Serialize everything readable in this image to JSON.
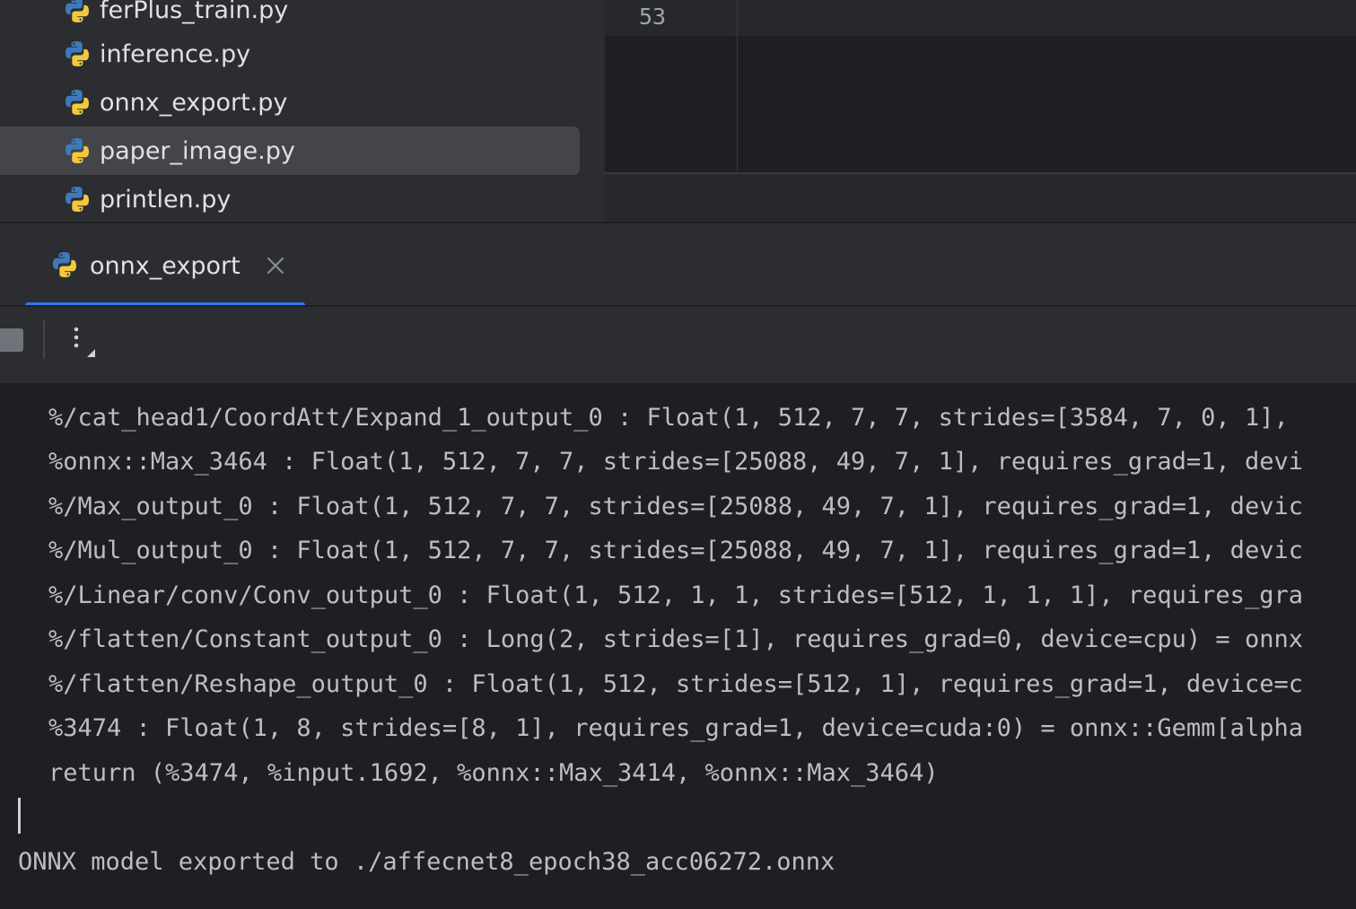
{
  "project_tree": {
    "items": [
      {
        "label": "ferPlus_train.py",
        "icon": "python-file-icon",
        "selected": false
      },
      {
        "label": "inference.py",
        "icon": "python-file-icon",
        "selected": false
      },
      {
        "label": "onnx_export.py",
        "icon": "python-file-icon",
        "selected": false
      },
      {
        "label": "paper_image.py",
        "icon": "python-file-icon",
        "selected": true
      },
      {
        "label": "printlen.py",
        "icon": "python-file-icon",
        "selected": false
      }
    ]
  },
  "editor": {
    "line_number": "53"
  },
  "run_window": {
    "tab": {
      "label": "onnx_export",
      "icon": "python-file-icon",
      "close_icon": "close-icon"
    },
    "toolbar": {
      "stop_icon": "stop-icon",
      "more_icon": "more-vertical-icon"
    }
  },
  "console": {
    "lines": [
      "%/cat_head1/CoordAtt/Expand_1_output_0 : Float(1, 512, 7, 7, strides=[3584, 7, 0, 1], ",
      "%onnx::Max_3464 : Float(1, 512, 7, 7, strides=[25088, 49, 7, 1], requires_grad=1, devi",
      "%/Max_output_0 : Float(1, 512, 7, 7, strides=[25088, 49, 7, 1], requires_grad=1, devic",
      "%/Mul_output_0 : Float(1, 512, 7, 7, strides=[25088, 49, 7, 1], requires_grad=1, devic",
      "%/Linear/conv/Conv_output_0 : Float(1, 512, 1, 1, strides=[512, 1, 1, 1], requires_gra",
      "%/flatten/Constant_output_0 : Long(2, strides=[1], requires_grad=0, device=cpu) = onnx",
      "%/flatten/Reshape_output_0 : Float(1, 512, strides=[512, 1], requires_grad=1, device=c",
      "%3474 : Float(1, 8, strides=[8, 1], requires_grad=1, device=cuda:0) = onnx::Gemm[alpha",
      "return (%3474, %input.1692, %onnx::Max_3414, %onnx::Max_3464)"
    ],
    "final_line": "ONNX model exported to ./affecnet8_epoch38_acc06272.onnx"
  },
  "colors": {
    "panel_bg": "#2b2d30",
    "editor_bg": "#1e1f22",
    "selection_bg": "#43454a",
    "accent_tab": "#3574f0",
    "text": "#dfe1e5",
    "console_text": "#bcbec4",
    "python_blue": "#3d7ab8",
    "python_yellow": "#f3c83d"
  }
}
